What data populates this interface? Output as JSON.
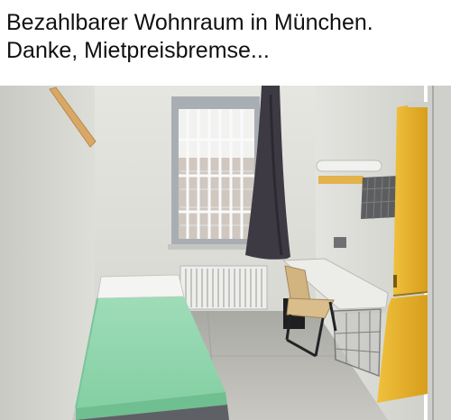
{
  "caption": {
    "line1": "Bezahlbarer Wohnraum in München.",
    "line2": "Danke, Mietpreisbremse..."
  },
  "photo": {
    "subject": "small cell-like room with barred window, foam mattress bed, radiator, desk, chair and yellow wardrobe",
    "colors": {
      "walls": "#dcddd8",
      "floor": "#b9b8b2",
      "mattress": "#8fd6ad",
      "curtain": "#3d3a44",
      "wardrobe": "#e8b32c",
      "window_frame": "#aab0b4"
    }
  }
}
